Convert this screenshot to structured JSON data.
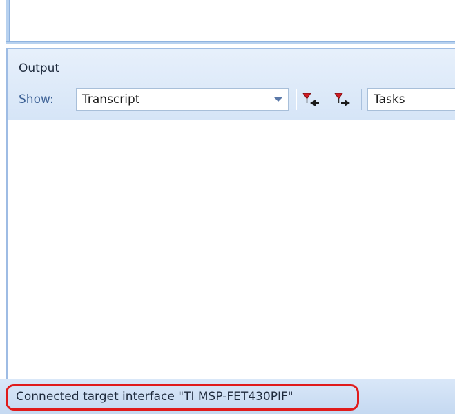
{
  "output_panel": {
    "title": "Output",
    "show_label": "Show:",
    "show_selected": "Transcript",
    "toolbar": {
      "previous_error_icon": "previous-error-icon",
      "next_error_icon": "next-error-icon"
    },
    "tasks_value": "Tasks"
  },
  "status_bar": {
    "message": "Connected target interface \"TI MSP-FET430PIF\"",
    "highlight_color": "#e01b1b"
  },
  "colors": {
    "panel_border": "#9ebce4",
    "header_background": "#d6e5f7",
    "status_background": "#c5d9f1"
  }
}
